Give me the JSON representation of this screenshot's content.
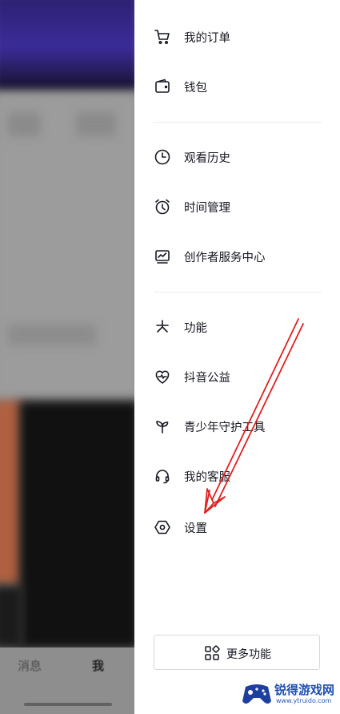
{
  "background": {
    "tabs": {
      "messages": "消息",
      "me": "我"
    }
  },
  "drawer": {
    "items": [
      {
        "label": "我的订单",
        "icon": "cart-icon"
      },
      {
        "label": "钱包",
        "icon": "wallet-icon"
      },
      {
        "label": "观看历史",
        "icon": "clock-icon"
      },
      {
        "label": "时间管理",
        "icon": "alarm-clock-icon"
      },
      {
        "label": "创作者服务中心",
        "icon": "chart-monitor-icon"
      },
      {
        "label": "功能",
        "icon": "asterisk-icon"
      },
      {
        "label": "抖音公益",
        "icon": "heart-pulse-icon"
      },
      {
        "label": "青少年守护工具",
        "icon": "sprout-icon"
      },
      {
        "label": "我的客服",
        "icon": "headset-icon"
      },
      {
        "label": "设置",
        "icon": "hexagon-settings-icon"
      }
    ],
    "more_button": {
      "label": "更多功能",
      "icon": "grid-icon"
    }
  },
  "watermark": {
    "title": "锐得游戏网",
    "url": "www.ytruido.com"
  },
  "colors": {
    "annotation_arrow": "#e02020",
    "watermark_blue": "#1e4fb0"
  }
}
